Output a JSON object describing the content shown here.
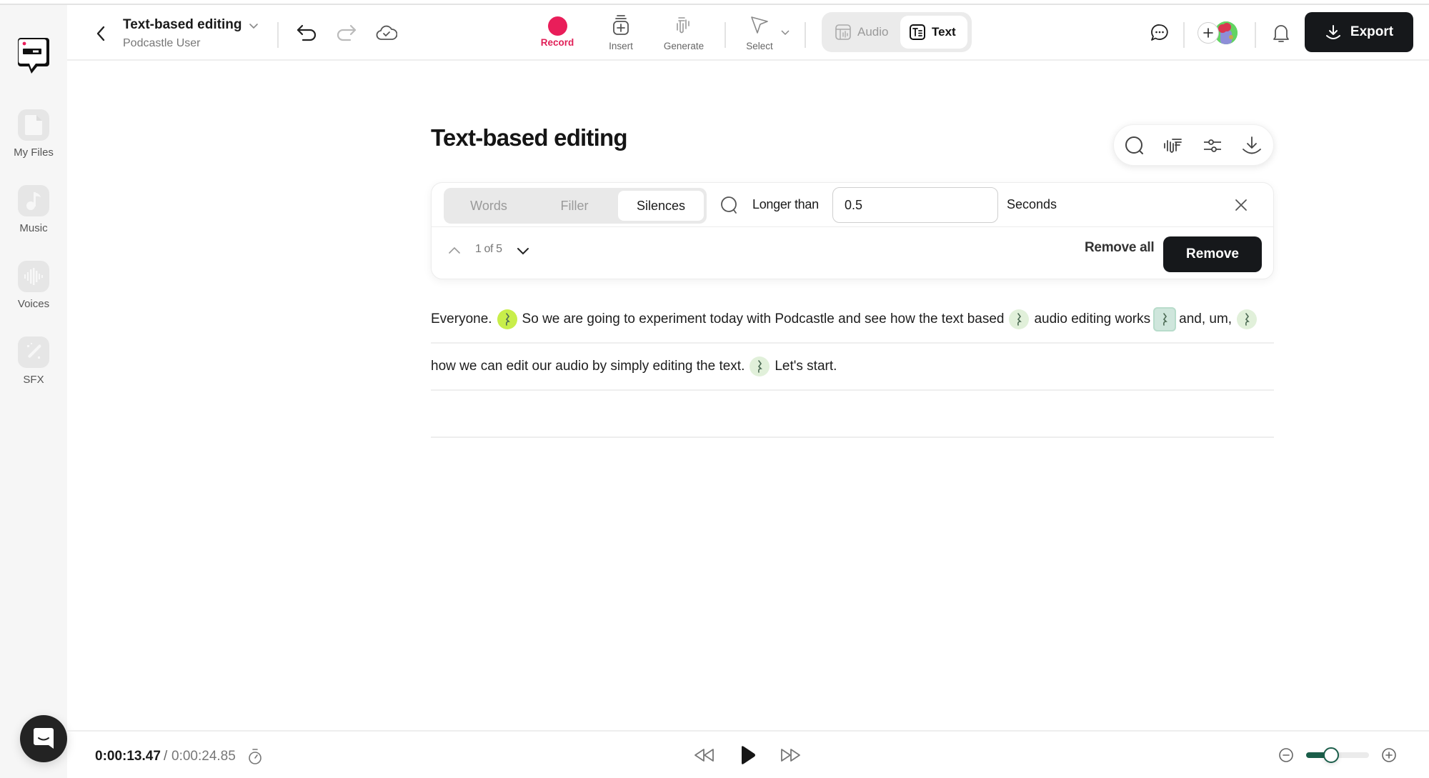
{
  "sidebar": {
    "items": [
      {
        "label": "My Files",
        "icon": "file-icon"
      },
      {
        "label": "Music",
        "icon": "music-note-icon"
      },
      {
        "label": "Voices",
        "icon": "waveform-icon"
      },
      {
        "label": "SFX",
        "icon": "magic-wand-icon"
      }
    ]
  },
  "header": {
    "project_title": "Text-based editing",
    "project_user": "Podcastle User",
    "tools": [
      {
        "label": "Record"
      },
      {
        "label": "Insert"
      },
      {
        "label": "Generate"
      },
      {
        "label": "Select"
      }
    ],
    "modes": [
      {
        "label": "Audio",
        "active": false
      },
      {
        "label": "Text",
        "active": true
      }
    ],
    "export_label": "Export"
  },
  "main": {
    "page_title": "Text-based editing",
    "filter": {
      "tabs": [
        {
          "label": "Words",
          "active": false
        },
        {
          "label": "Filler",
          "active": false
        },
        {
          "label": "Silences",
          "active": true
        }
      ],
      "longer_than_label": "Longer than",
      "threshold_value": "0.5",
      "unit_label": "Seconds",
      "match_count": "1 of 5",
      "remove_all_label": "Remove all",
      "remove_label": "Remove"
    },
    "transcript": {
      "line1": {
        "w1": "Everyone.",
        "w2": "So we are going to experiment today with Podcastle and see how the text based",
        "w3": "audio editing works",
        "w4": "and, um,"
      },
      "line2": {
        "w1": "how we can edit our audio by simply editing the text.",
        "w2": "Let's start."
      }
    }
  },
  "player": {
    "current_time": "0:00:13.47",
    "separator": "/",
    "total_time": "0:00:24.85",
    "zoom_level_fraction": 0.4
  },
  "colors": {
    "record": "#e91e5a",
    "accent_green": "#1b5e4a",
    "silence_highlight": "#c8ee4a",
    "dark_button": "#16181b"
  }
}
